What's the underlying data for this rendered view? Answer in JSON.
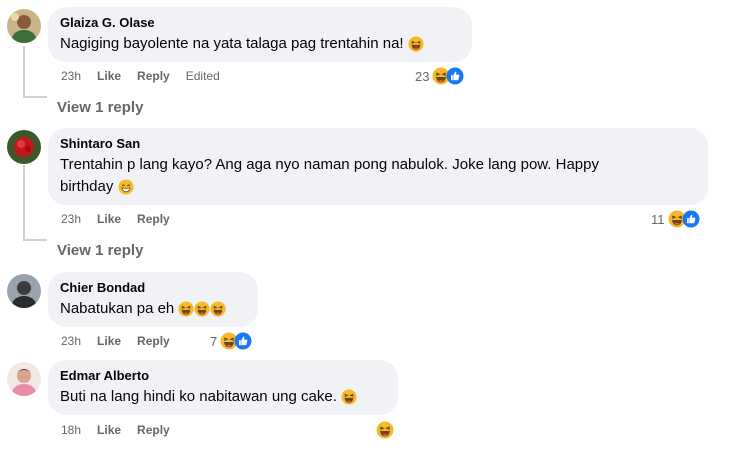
{
  "comments": [
    {
      "author": "Glaiza G. Olase",
      "text": "Nagiging bayolente na yata talaga pag trentahin na!",
      "time": "23h",
      "like_label": "Like",
      "reply_label": "Reply",
      "edited_label": "Edited",
      "reaction_count": "23",
      "reactions": [
        "haha-icon",
        "like-icon"
      ],
      "view_replies": "View 1 reply"
    },
    {
      "author": "Shintaro San",
      "text_line1": "Trentahin p lang kayo? Ang aga nyo naman pong nabulok. Joke lang pow. Happy",
      "text_line2": "birthday",
      "time": "23h",
      "like_label": "Like",
      "reply_label": "Reply",
      "reaction_count": "11",
      "reactions": [
        "haha-icon",
        "like-icon"
      ],
      "view_replies": "View 1 reply"
    },
    {
      "author": "Chier Bondad",
      "text": "Nabatukan pa eh",
      "time": "23h",
      "like_label": "Like",
      "reply_label": "Reply",
      "reaction_count": "7",
      "reactions": [
        "haha-icon",
        "like-icon"
      ]
    },
    {
      "author": "Edmar Alberto",
      "text": "Buti na lang hindi ko nabitawan ung cake.",
      "time": "18h",
      "like_label": "Like",
      "reply_label": "Reply",
      "reactions": [
        "haha-icon"
      ]
    }
  ],
  "colors": {
    "bubble": "#f0f2f5",
    "secondary_text": "#65676b",
    "like_blue": "#1877f2",
    "haha_yellow": "#f7b928"
  }
}
